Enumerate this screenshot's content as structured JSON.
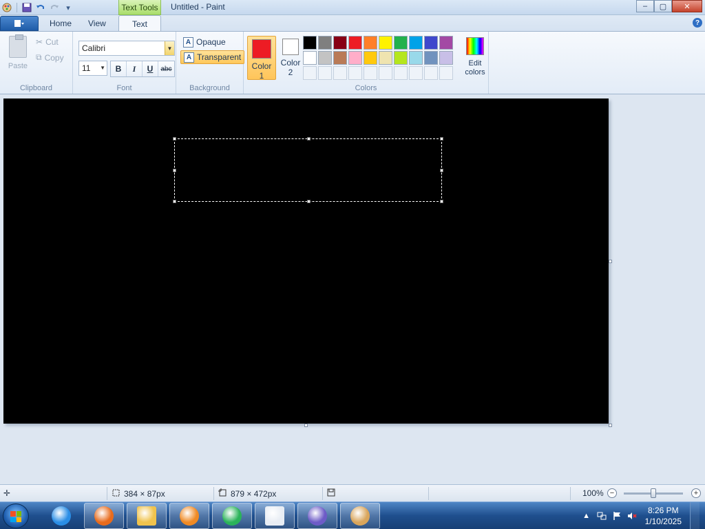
{
  "window": {
    "title": "Untitled - Paint",
    "context_tab": "Text Tools",
    "controls": {
      "minimize": "–",
      "maximize": "▢",
      "close": "✕"
    }
  },
  "quick_access": {
    "app_menu_icon": "paint-icon",
    "save_icon": "save-icon",
    "undo_icon": "undo-icon",
    "redo_icon": "redo-icon",
    "customize_icon": "dropdown-icon"
  },
  "ribbon": {
    "tabs": [
      {
        "label": "Home"
      },
      {
        "label": "View"
      },
      {
        "label": "Text"
      }
    ],
    "active_tab": "Text",
    "help_symbol": "?",
    "clipboard": {
      "label": "Clipboard",
      "paste": "Paste",
      "cut": "Cut",
      "copy": "Copy"
    },
    "font": {
      "label": "Font",
      "family": "Calibri",
      "size": "11",
      "bold": "B",
      "italic": "I",
      "underline": "U",
      "strikethrough": "abc"
    },
    "background": {
      "label": "Background",
      "opaque": "Opaque",
      "transparent": "Transparent",
      "selected": "Transparent"
    },
    "colors": {
      "label": "Colors",
      "color1": {
        "line1": "Color",
        "line2": "1",
        "value": "#ed1c24"
      },
      "color2": {
        "line1": "Color",
        "line2": "2",
        "value": "#ffffff"
      },
      "edit": {
        "line1": "Edit",
        "line2": "colors"
      },
      "palette_row1": [
        "#000000",
        "#7f7f7f",
        "#880015",
        "#ed1c24",
        "#ff7f27",
        "#fff200",
        "#22b14c",
        "#00a2e8",
        "#3f48cc",
        "#a349a4"
      ],
      "palette_row2": [
        "#ffffff",
        "#c3c3c3",
        "#b97a57",
        "#ffaec9",
        "#ffc90e",
        "#efe4b0",
        "#b5e61d",
        "#99d9ea",
        "#7092be",
        "#c8bfe7"
      ]
    }
  },
  "canvas": {
    "background": "#000000"
  },
  "status": {
    "selection_size": "384 × 87px",
    "canvas_size": "879 × 472px",
    "zoom": "100%",
    "zoom_out": "−",
    "zoom_in": "+",
    "zoom_level": 0.5
  },
  "taskbar": {
    "apps": [
      {
        "name": "internet-explorer-icon",
        "color": "#2a8ee6"
      },
      {
        "name": "firefox-icon",
        "color": "#e86b1c"
      },
      {
        "name": "file-explorer-icon",
        "color": "#f0c34d"
      },
      {
        "name": "media-player-icon",
        "color": "#f08a24"
      },
      {
        "name": "media-center-icon",
        "color": "#2bb35a"
      },
      {
        "name": "news-icon",
        "color": "#e8edf4"
      },
      {
        "name": "visual-studio-icon",
        "color": "#6d5bc7"
      },
      {
        "name": "paint-icon",
        "color": "#d9a55b"
      }
    ],
    "time": "8:26 PM",
    "date": "1/10/2025"
  }
}
